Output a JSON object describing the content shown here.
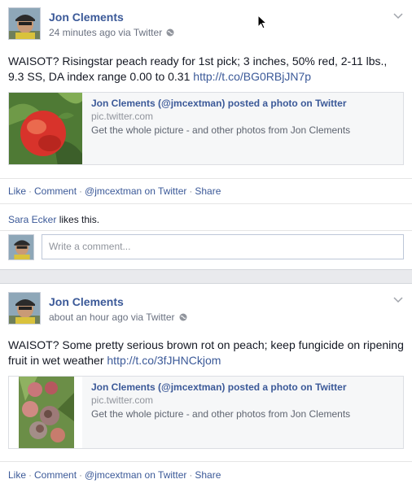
{
  "posts": [
    {
      "author": "Jon Clements",
      "meta": "24 minutes ago via Twitter",
      "text": "WAISOT? Risingstar peach ready for 1st pick; 3 inches, 50% red, 2-11 lbs., 9.3 SS, DA index range 0.00 to 0.31",
      "link": "http://t.co/BG0RBjJN7p",
      "card": {
        "title": "Jon Clements (@jmcextman) posted a photo on Twitter",
        "source": "pic.twitter.com",
        "description": "Get the whole picture - and other photos from Jon Clements"
      },
      "actions": [
        "Like",
        "Comment",
        "@jmcextman on Twitter",
        "Share"
      ],
      "liker": "Sara Ecker",
      "likes_suffix": "likes this.",
      "comment_placeholder": "Write a comment..."
    },
    {
      "author": "Jon Clements",
      "meta": "about an hour ago via Twitter",
      "text": "WAISOT? Some pretty serious brown rot on peach; keep fungicide on ripening fruit in wet weather",
      "link": "http://t.co/3fJHNCkjom",
      "card": {
        "title": "Jon Clements (@jmcextman) posted a photo on Twitter",
        "source": "pic.twitter.com",
        "description": "Get the whole picture - and other photos from Jon Clements"
      },
      "actions": [
        "Like",
        "Comment",
        "@jmcextman on Twitter",
        "Share"
      ]
    }
  ],
  "icons": {
    "globe": "globe-icon",
    "chevron": "chevron-down-icon",
    "cursor": "mouse-cursor"
  },
  "colors": {
    "link": "#3b5998",
    "meta": "#6a7180",
    "separator": "#e9eaed"
  }
}
